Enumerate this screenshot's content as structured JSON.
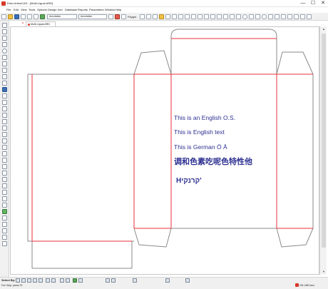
{
  "window": {
    "title": "Esko ArtiosCAD - [Multi-Ligual.ARD]",
    "minimize_glyph": "—",
    "maximize_glyph": "☐",
    "close_glyph": "✕"
  },
  "menu": [
    "File",
    "Edit",
    "View",
    "Tools",
    "Options",
    "Design",
    "Info",
    "Database",
    "Reports",
    "Parameters",
    "Window",
    "Help"
  ],
  "toolbar": {
    "layer_value": "Annotation",
    "layer2_value": "Annotation",
    "polygon_label": "Polygon",
    "icons": [
      "new-icon",
      "open-icon",
      "save-icon",
      "print-icon",
      "undo-icon",
      "redo-icon",
      "layer-icon",
      "grid-icon",
      "line-tool-icon",
      "arc-tool-icon",
      "circle-tool-icon",
      "zoom-icon",
      "settings-icon"
    ]
  },
  "document": {
    "tab_title": "Multi-Ligual.ARD",
    "tab_close": "×"
  },
  "canvas": {
    "text_lines": [
      "This is an English O.S.",
      "This is English text",
      "This is German Ö Ä",
      "调和色素吃呢色特性他",
      "Hקרנקי'"
    ],
    "text_color": "#2e3192",
    "cut_line_color": "#8a8a8a",
    "crease_line_color": "#e8303a"
  },
  "select_bar": {
    "label": "Select By:"
  },
  "scrollbar": {
    "up_glyph": "▲",
    "down_glyph": "▼"
  },
  "status": {
    "text": "For Help, press F1",
    "badge": "ON LINE.bms"
  }
}
